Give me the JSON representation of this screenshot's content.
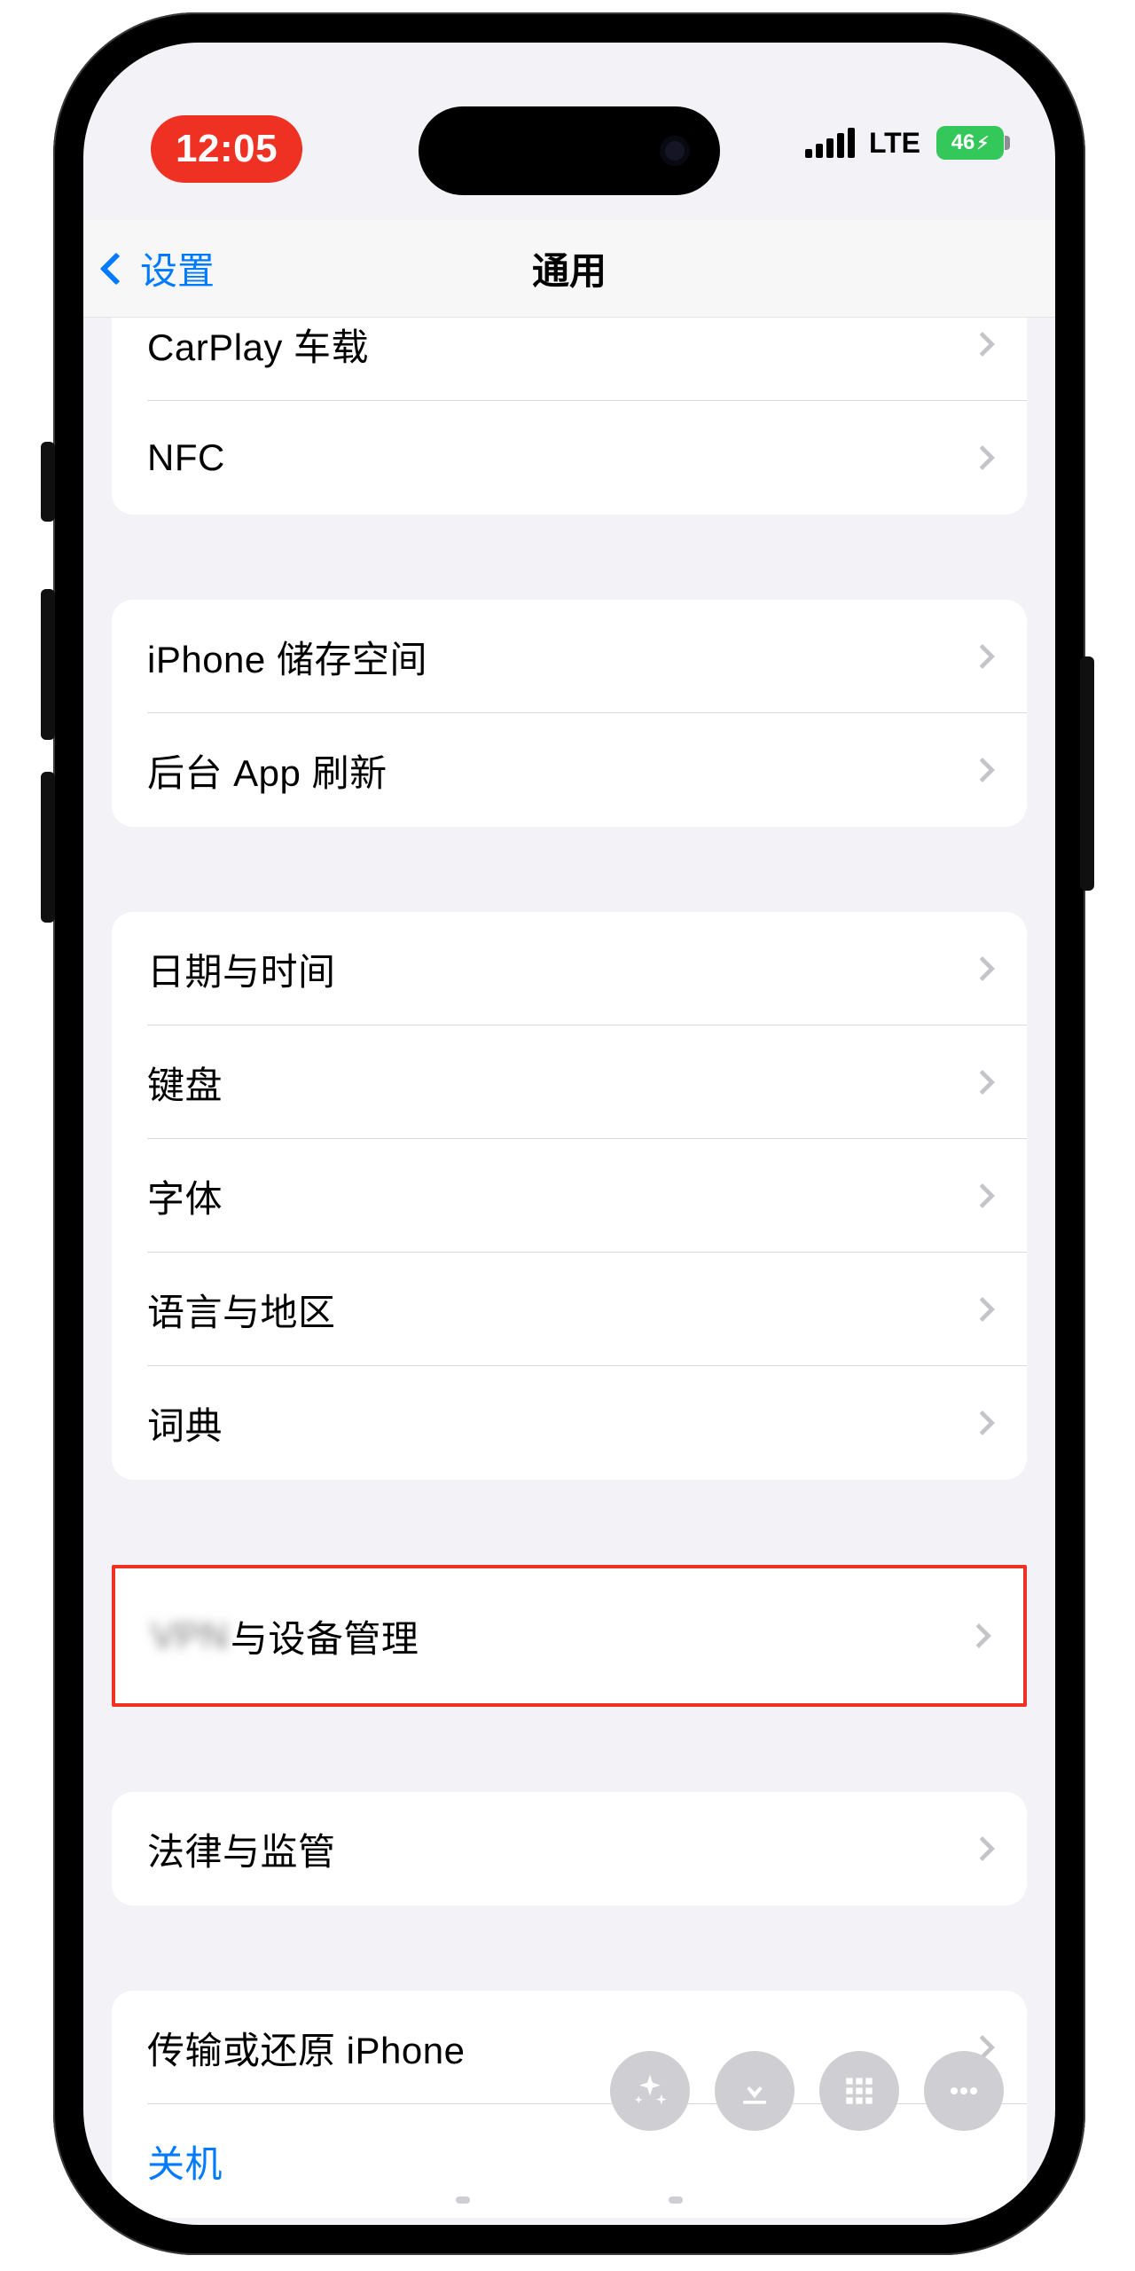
{
  "statusbar": {
    "time": "12:05",
    "network": "LTE",
    "battery": "46"
  },
  "nav": {
    "back_label": "设置",
    "title": "通用"
  },
  "group0": {
    "carplay": "CarPlay 车载",
    "nfc": "NFC"
  },
  "group1": {
    "storage": "iPhone 储存空间",
    "bg_refresh": "后台 App 刷新"
  },
  "group2": {
    "datetime": "日期与时间",
    "keyboard": "键盘",
    "fonts": "字体",
    "language": "语言与地区",
    "dictionary": "词典"
  },
  "group3": {
    "vpn_blur": "VPN",
    "vpn_rest": "与设备管理"
  },
  "group4": {
    "legal": "法律与监管"
  },
  "group5": {
    "transfer": "传输或还原 iPhone",
    "shutdown": "关机"
  }
}
